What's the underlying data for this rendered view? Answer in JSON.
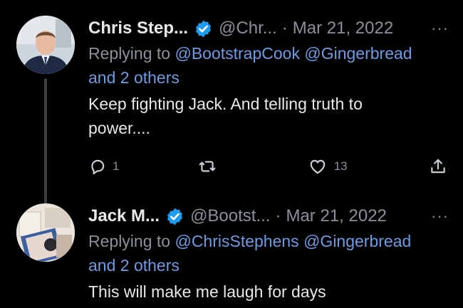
{
  "tweets": [
    {
      "name": "Chris Step...",
      "handle": "@Chr...",
      "separator": "·",
      "date": "Mar 21, 2022",
      "more": "···",
      "replying_prefix": "Replying to",
      "mentions": [
        "@BootstrapCook",
        "@Gingerbread"
      ],
      "others": "and 2 others",
      "text_lines": [
        "Keep fighting Jack. And telling truth to",
        "power...."
      ],
      "reply_count": "1",
      "like_count": "13"
    },
    {
      "name": "Jack M...",
      "handle": "@Bootst...",
      "separator": "·",
      "date": "Mar 21, 2022",
      "more": "···",
      "replying_prefix": "Replying to",
      "mentions": [
        "@ChrisStephens",
        "@Gingerbread"
      ],
      "others": "and 2 others",
      "text_lines": [
        "This will make me laugh for days"
      ]
    }
  ],
  "icons": {
    "verified": "verified-badge-icon",
    "reply": "reply-icon",
    "retweet": "retweet-icon",
    "like": "heart-icon",
    "share": "share-icon"
  },
  "colors": {
    "background": "#000000",
    "text": "#e7e9ea",
    "muted": "#8b9198",
    "mention": "#6d9be6",
    "verified": "#1d9bf0"
  }
}
